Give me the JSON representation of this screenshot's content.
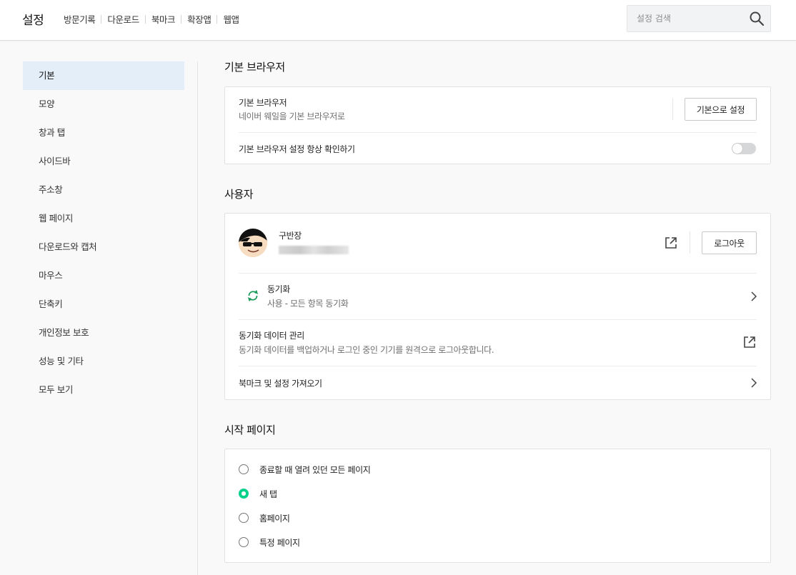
{
  "header": {
    "title": "설정",
    "nav": [
      "방문기록",
      "다운로드",
      "북마크",
      "확장앱",
      "웹앱"
    ],
    "search_placeholder": "설정 검색"
  },
  "sidebar": {
    "items": [
      {
        "label": "기본",
        "active": true
      },
      {
        "label": "모양"
      },
      {
        "label": "창과 탭"
      },
      {
        "label": "사이드바"
      },
      {
        "label": "주소창"
      },
      {
        "label": "웹 페이지"
      },
      {
        "label": "다운로드와 캡처"
      },
      {
        "label": "마우스"
      },
      {
        "label": "단축키"
      },
      {
        "label": "개인정보 보호"
      },
      {
        "label": "성능 및 기타"
      },
      {
        "label": "모두 보기"
      }
    ]
  },
  "default_browser": {
    "section_title": "기본 브라우저",
    "row_title": "기본 브라우저",
    "row_sub": "네이버 웨일을 기본 브라우저로",
    "set_default_label": "기본으로 설정",
    "check_label": "기본 브라우저 설정 항상 확인하기",
    "check_enabled": false
  },
  "user": {
    "section_title": "사용자",
    "name": "구반장",
    "logout_label": "로그아웃",
    "sync_title": "동기화",
    "sync_sub": "사용 - 모든 항목 동기화",
    "sync_data_title": "동기화 데이터 관리",
    "sync_data_sub": "동기화 데이터를 백업하거나 로그인 중인 기기를 원격으로 로그아웃합니다.",
    "import_label": "북마크 및 설정 가져오기"
  },
  "startup": {
    "section_title": "시작 페이지",
    "options": [
      {
        "label": "종료할 때 열려 있던 모든 페이지",
        "checked": false
      },
      {
        "label": "새 탭",
        "checked": true
      },
      {
        "label": "홈페이지",
        "checked": false
      },
      {
        "label": "특정 페이지",
        "checked": false
      }
    ]
  },
  "colors": {
    "accent_green": "#06d18b",
    "sync_icon_green": "#1a9a5a",
    "active_sidebar_bg": "#e3eef9"
  }
}
